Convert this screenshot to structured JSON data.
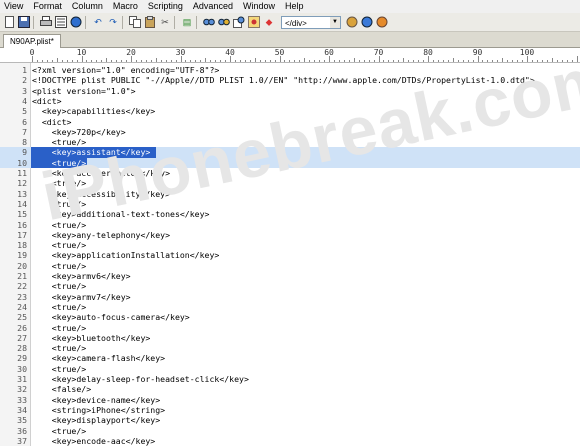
{
  "menu": [
    "View",
    "Format",
    "Column",
    "Macro",
    "Scripting",
    "Advanced",
    "Window",
    "Help"
  ],
  "toolbar": {
    "icons": [
      "new-file-icon",
      "save-icon",
      "print-icon",
      "list-icon",
      "open-browser-icon",
      "undo-icon",
      "redo-icon",
      "copy-icon",
      "paste-icon",
      "find-icon",
      "replace-icon",
      "tag-icon"
    ],
    "tag_combo_value": "</div>"
  },
  "tab": {
    "label": "N90AP.plist*"
  },
  "ruler": {
    "marks": [
      "0",
      "10",
      "20",
      "30",
      "40",
      "50",
      "60",
      "70",
      "80",
      "90",
      "100"
    ]
  },
  "watermark": "iPhonebreak.com",
  "editor": {
    "lines": [
      {
        "n": "1",
        "text": "<?xml version=\"1.0\" encoding=\"UTF-8\"?>"
      },
      {
        "n": "2",
        "text": "<!DOCTYPE plist PUBLIC \"-//Apple//DTD PLIST 1.0//EN\" \"http://www.apple.com/DTDs/PropertyList-1.0.dtd\">"
      },
      {
        "n": "3",
        "text": "<plist version=\"1.0\">"
      },
      {
        "n": "4",
        "text": "<dict>"
      },
      {
        "n": "5",
        "text": "  <key>capabilities</key>"
      },
      {
        "n": "6",
        "text": "  <dict>"
      },
      {
        "n": "7",
        "text": "    <key>720p</key>"
      },
      {
        "n": "8",
        "text": "    <true/>"
      },
      {
        "n": "9",
        "text": "    <key>assistant</key>"
      },
      {
        "n": "10",
        "text": "    <true/>"
      },
      {
        "n": "11",
        "text": "    <key>accelerometer</key>"
      },
      {
        "n": "12",
        "text": "    <true/>"
      },
      {
        "n": "13",
        "text": "    <key>accessibility</key>"
      },
      {
        "n": "14",
        "text": "    <true/>"
      },
      {
        "n": "15",
        "text": "    <key>additional-text-tones</key>"
      },
      {
        "n": "16",
        "text": "    <true/>"
      },
      {
        "n": "17",
        "text": "    <key>any-telephony</key>"
      },
      {
        "n": "18",
        "text": "    <true/>"
      },
      {
        "n": "19",
        "text": "    <key>applicationInstallation</key>"
      },
      {
        "n": "20",
        "text": "    <true/>"
      },
      {
        "n": "21",
        "text": "    <key>armv6</key>"
      },
      {
        "n": "22",
        "text": "    <true/>"
      },
      {
        "n": "23",
        "text": "    <key>armv7</key>"
      },
      {
        "n": "24",
        "text": "    <true/>"
      },
      {
        "n": "25",
        "text": "    <key>auto-focus-camera</key>"
      },
      {
        "n": "26",
        "text": "    <true/>"
      },
      {
        "n": "27",
        "text": "    <key>bluetooth</key>"
      },
      {
        "n": "28",
        "text": "    <true/>"
      },
      {
        "n": "29",
        "text": "    <key>camera-flash</key>"
      },
      {
        "n": "30",
        "text": "    <true/>"
      },
      {
        "n": "31",
        "text": "    <key>delay-sleep-for-headset-click</key>"
      },
      {
        "n": "32",
        "text": "    <false/>"
      },
      {
        "n": "33",
        "text": "    <key>device-name</key>"
      },
      {
        "n": "34",
        "text": "    <string>iPhone</string>"
      },
      {
        "n": "35",
        "text": "    <key>displayport</key>"
      },
      {
        "n": "36",
        "text": "    <true/>"
      },
      {
        "n": "37",
        "text": "    <key>encode-aac</key>"
      }
    ],
    "selected_lines": [
      "9",
      "10"
    ],
    "current_line": "1"
  }
}
